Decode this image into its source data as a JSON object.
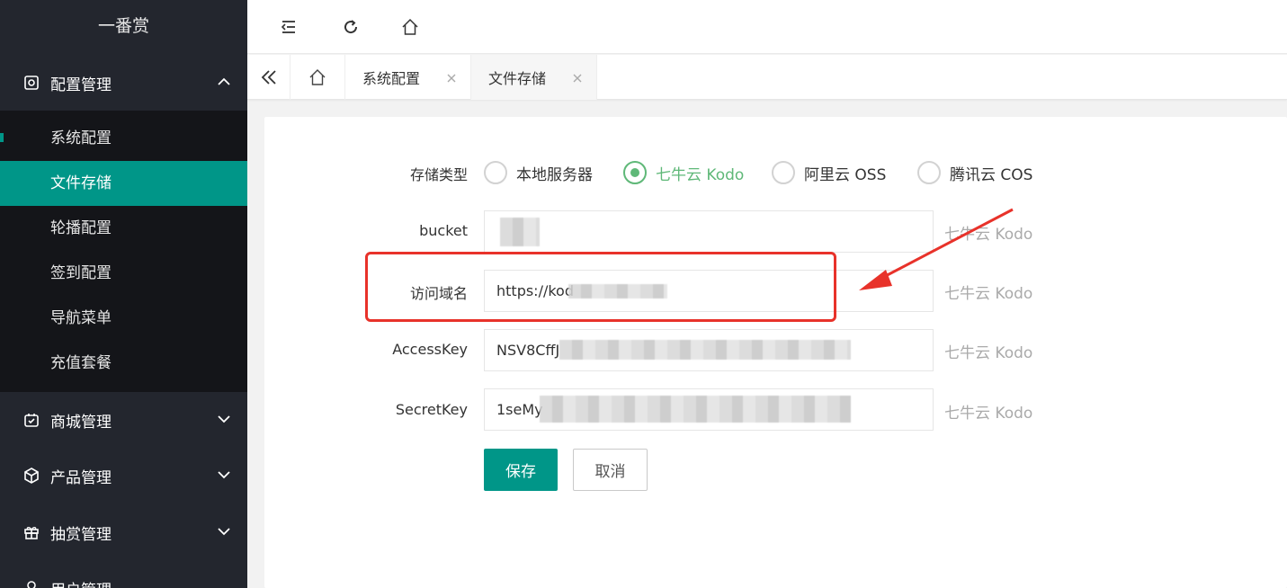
{
  "app": {
    "title": "一番赏"
  },
  "sidebar": {
    "groups": [
      {
        "label": "配置管理",
        "icon": "settings-icon",
        "expanded": true
      },
      {
        "label": "商城管理",
        "icon": "shop-icon",
        "expanded": false
      },
      {
        "label": "产品管理",
        "icon": "box-icon",
        "expanded": false
      },
      {
        "label": "抽赏管理",
        "icon": "gift-icon",
        "expanded": false
      },
      {
        "label": "用户管理",
        "icon": "user-icon",
        "expanded": false
      }
    ],
    "sub_items": [
      "系统配置",
      "文件存储",
      "轮播配置",
      "签到配置",
      "导航菜单",
      "充值套餐"
    ],
    "active_sub": "文件存储"
  },
  "tabs": [
    {
      "label": "系统配置",
      "active": false
    },
    {
      "label": "文件存储",
      "active": true
    }
  ],
  "form": {
    "storage_type_label": "存储类型",
    "storage_options": [
      "本地服务器",
      "七牛云 Kodo",
      "阿里云 OSS",
      "腾讯云 COS"
    ],
    "selected_option": "七牛云 Kodo",
    "fields": [
      {
        "label": "bucket",
        "value": "",
        "hint": "七牛云 Kodo"
      },
      {
        "label": "访问域名",
        "value": "https://kod",
        "hint": "七牛云 Kodo"
      },
      {
        "label": "AccessKey",
        "value": "NSV8CffJ",
        "hint": "七牛云 Kodo"
      },
      {
        "label": "SecretKey",
        "value": "1seMy",
        "hint": "七牛云 Kodo"
      }
    ],
    "save_label": "保存",
    "cancel_label": "取消"
  },
  "colors": {
    "accent": "#009688",
    "radio_checked": "#5fb878",
    "sidebar_bg": "#23262e",
    "annotation_red": "#e8322a"
  }
}
